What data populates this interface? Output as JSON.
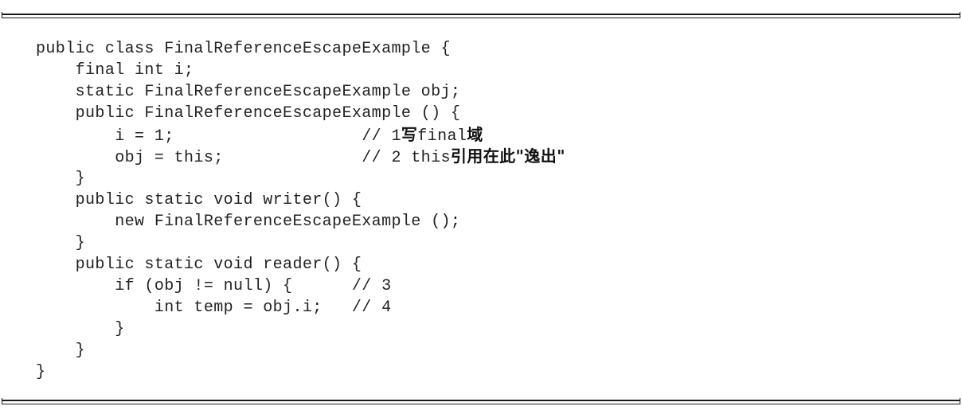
{
  "code_listing": {
    "lines": [
      {
        "code": "public class FinalReferenceEscapeExample {",
        "comment": ""
      },
      {
        "code": "    final int i;",
        "comment": ""
      },
      {
        "code": "    static FinalReferenceEscapeExample obj;",
        "comment": ""
      },
      {
        "code": "    public FinalReferenceEscapeExample () {",
        "comment": ""
      },
      {
        "code": "        i = 1;                   ",
        "comment": "// 1写final域"
      },
      {
        "code": "        obj = this;              ",
        "comment": "// 2 this引用在此\"逸出\""
      },
      {
        "code": "    }",
        "comment": ""
      },
      {
        "code": "    public static void writer() {",
        "comment": ""
      },
      {
        "code": "        new FinalReferenceEscapeExample ();",
        "comment": ""
      },
      {
        "code": "    }",
        "comment": ""
      },
      {
        "code": "    public static void reader() {",
        "comment": ""
      },
      {
        "code": "        if (obj != null) {      ",
        "comment": "// 3"
      },
      {
        "code": "            int temp = obj.i;   ",
        "comment": "// 4"
      },
      {
        "code": "        }",
        "comment": ""
      },
      {
        "code": "    }",
        "comment": ""
      },
      {
        "code": "}",
        "comment": ""
      }
    ]
  }
}
